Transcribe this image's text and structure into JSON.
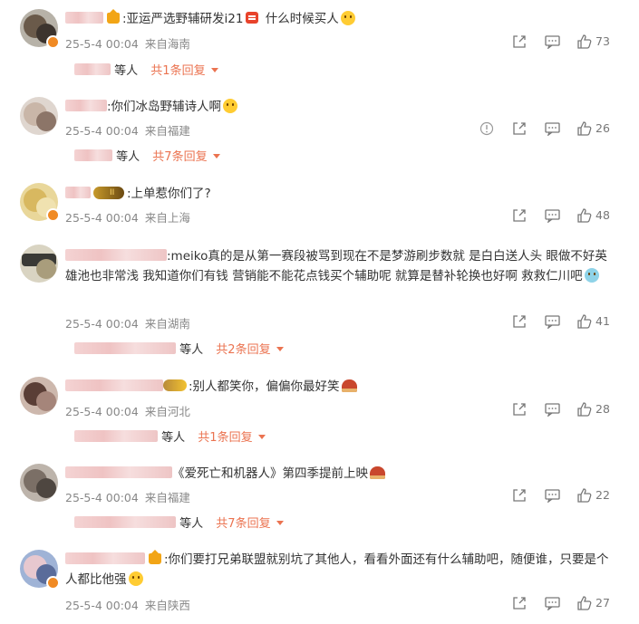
{
  "colors": {
    "accent": "#eb7350",
    "meta": "#888888"
  },
  "comments": [
    {
      "content": ":亚运严选野辅研发i21",
      "content2": " 什么时候买人",
      "time": "25-5-4 00:04",
      "location": "来自海南",
      "likes": "73",
      "replies_prefix": "等人",
      "replies_more": "共1条回复"
    },
    {
      "content": ":你们冰岛野辅诗人啊",
      "time": "25-5-4 00:04",
      "location": "来自福建",
      "likes": "26",
      "replies_prefix": "等人",
      "replies_more": "共7条回复"
    },
    {
      "content": ":上单惹你们了?",
      "time": "25-5-4 00:04",
      "location": "来自上海",
      "likes": "48"
    },
    {
      "content": ":meiko真的是从第一赛段被骂到现在不是梦游刷步数就 是白白送人头 眼做不好英雄池也非常浅 我知道你们有钱 营销能不能花点钱买个辅助呢 就算是替补轮换也好啊 救救仁川吧",
      "time": "25-5-4 00:04",
      "location": "来自湖南",
      "likes": "41",
      "replies_prefix": "等人",
      "replies_more": "共2条回复"
    },
    {
      "content": ":别人都笑你，偏偏你最好笑",
      "time": "25-5-4 00:04",
      "location": "来自河北",
      "likes": "28",
      "replies_prefix": "等人",
      "replies_more": "共1条回复"
    },
    {
      "content": "《爱死亡和机器人》第四季提前上映",
      "time": "25-5-4 00:04",
      "location": "来自福建",
      "likes": "22",
      "replies_prefix": "等人",
      "replies_more": "共7条回复"
    },
    {
      "content": ":你们要打兄弟联盟就别坑了其他人，看看外面还有什么辅助吧，随便谁，只要是个人都比他强",
      "time": "25-5-4 00:04",
      "location": "来自陕西",
      "likes": "27"
    }
  ]
}
